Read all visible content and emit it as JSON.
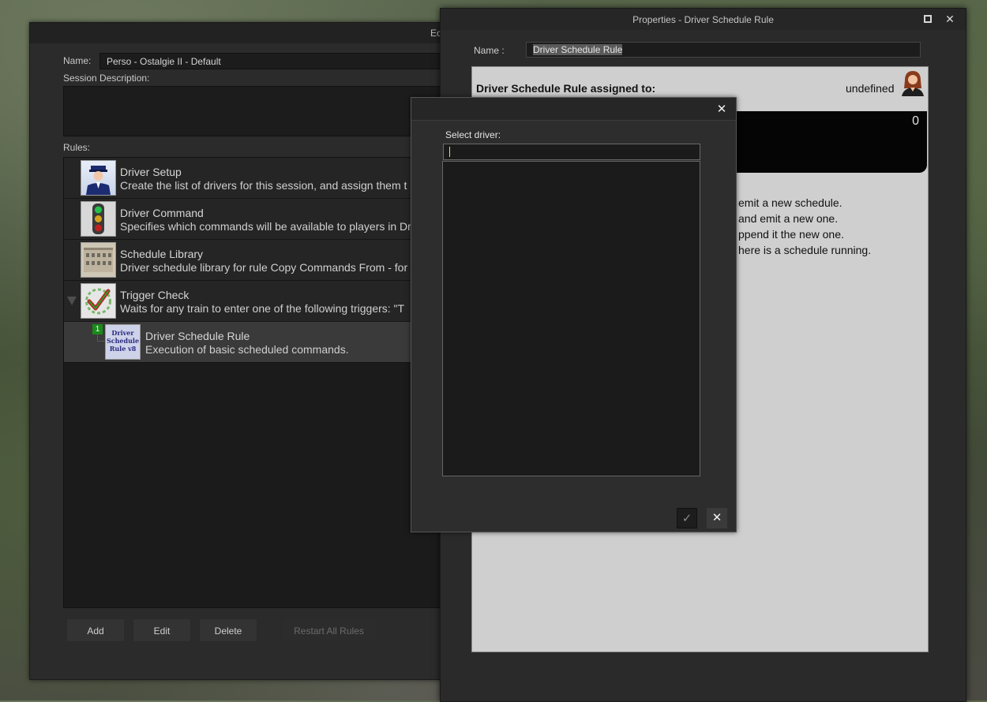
{
  "editor": {
    "title": "Ec",
    "name_label": "Name:",
    "name_value": "Perso - Ostalgie II - Default",
    "session_description_label": "Session Description:",
    "rules_label": "Rules:",
    "rules": [
      {
        "title": "Driver Setup",
        "description": "Create the list of drivers for this session, and assign them t",
        "icon": "conductor-icon"
      },
      {
        "title": "Driver Command",
        "description": "Specifies which commands will be available to players in Dr",
        "icon": "traffic-light-icon"
      },
      {
        "title": "Schedule Library",
        "description": "Driver schedule library for rule Copy Commands From - for",
        "icon": "building-icon"
      },
      {
        "title": "Trigger Check",
        "description": "Waits for any train to enter one of the following triggers: \"T",
        "icon": "checkmark-triggers-icon"
      },
      {
        "title": "Driver Schedule Rule",
        "description": "Execution of basic scheduled commands.",
        "icon": "schedule-rule-icon",
        "badge": "1",
        "thumb_text": [
          "Driver",
          "Schedule",
          "Rule v8"
        ]
      }
    ],
    "buttons": {
      "add": "Add",
      "edit": "Edit",
      "delete": "Delete",
      "restart": "Restart All Rules"
    }
  },
  "properties": {
    "title": "Properties - Driver Schedule Rule",
    "name_label": "Name :",
    "name_value": "Driver Schedule Rule",
    "assigned_label": "Driver Schedule Rule assigned to:",
    "assigned_value": "undefined",
    "counter": "0",
    "options": [
      "emit a new schedule.",
      "and emit a new one.",
      "ppend it the new one.",
      "here is a schedule running."
    ]
  },
  "dialog": {
    "label": "Select driver:",
    "input_value": "",
    "close_icon": "close-icon",
    "ok_icon": "checkmark-icon",
    "cancel_icon": "close-icon"
  }
}
